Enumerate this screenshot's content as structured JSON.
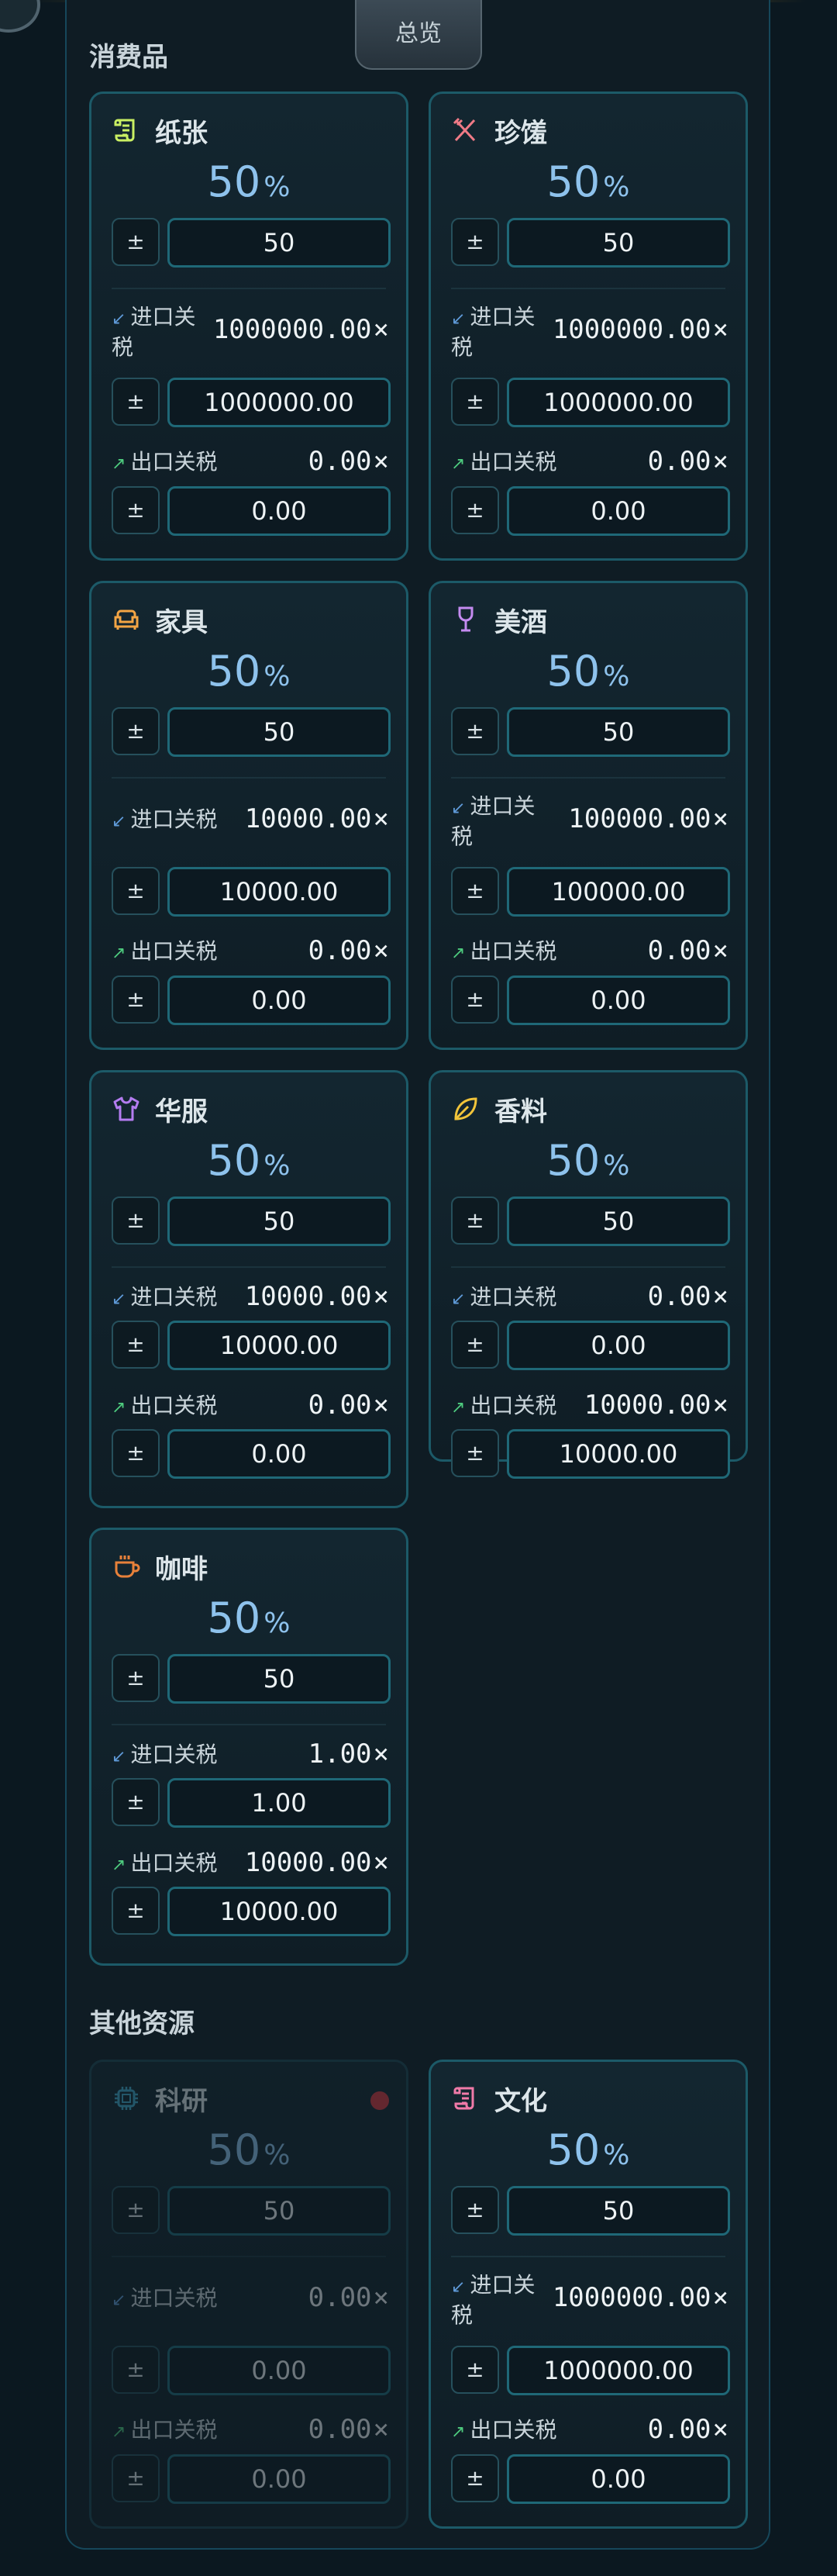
{
  "header": {
    "overview_tab": "总览"
  },
  "sections": [
    {
      "title": "消费品"
    },
    {
      "title": "其他资源"
    }
  ],
  "common": {
    "stepper_symbol": "±",
    "percent_unit": "%",
    "multiplier_symbol": "×"
  },
  "cards": [
    {
      "name": "纸张",
      "icon": "scroll-icon",
      "icon_color": "#c9ef63",
      "percent": "50",
      "amount": "50",
      "import_label": "进口关税",
      "import_value": "1000000.00",
      "import_input": "1000000.00",
      "export_label": "出口关税",
      "export_value": "0.00",
      "export_input": "0.00"
    },
    {
      "name": "珍馐",
      "icon": "fork-knife-icon",
      "icon_color": "#f07a86",
      "percent": "50",
      "amount": "50",
      "import_label": "进口关税",
      "import_value": "1000000.00",
      "import_input": "1000000.00",
      "export_label": "出口关税",
      "export_value": "0.00",
      "export_input": "0.00"
    },
    {
      "name": "家具",
      "icon": "sofa-icon",
      "icon_color": "#f3a544",
      "percent": "50",
      "amount": "50",
      "import_label": "进口关税",
      "import_value": "10000.00",
      "import_input": "10000.00",
      "export_label": "出口关税",
      "export_value": "0.00",
      "export_input": "0.00"
    },
    {
      "name": "美酒",
      "icon": "wine-glass-icon",
      "icon_color": "#c48bf0",
      "percent": "50",
      "amount": "50",
      "import_label": "进口关税",
      "import_value": "100000.00",
      "import_input": "100000.00",
      "export_label": "出口关税",
      "export_value": "0.00",
      "export_input": "0.00"
    },
    {
      "name": "华服",
      "icon": "shirt-icon",
      "icon_color": "#b47cf0",
      "percent": "50",
      "amount": "50",
      "import_label": "进口关税",
      "import_value": "10000.00",
      "import_input": "10000.00",
      "export_label": "出口关税",
      "export_value": "0.00",
      "export_input": "0.00"
    },
    {
      "name": "香料",
      "icon": "leaf-icon",
      "icon_color": "#f1c43a",
      "percent": "50",
      "amount": "50",
      "import_label": "进口关税",
      "import_value": "0.00",
      "import_input": "0.00",
      "export_label": "出口关税",
      "export_value": "10000.00",
      "export_input": "10000.00"
    },
    {
      "name": "咖啡",
      "icon": "coffee-cup-icon",
      "icon_color": "#e8813a",
      "percent": "50",
      "amount": "50",
      "import_label": "进口关税",
      "import_value": "1.00",
      "import_input": "1.00",
      "export_label": "出口关税",
      "export_value": "10000.00",
      "export_input": "10000.00"
    },
    {
      "name": "科研",
      "icon": "chip-icon",
      "icon_color": "#3fa7c9",
      "disabled": true,
      "status": "red-dot",
      "percent": "50",
      "amount": "50",
      "import_label": "进口关税",
      "import_value": "0.00",
      "import_input": "0.00",
      "export_label": "出口关税",
      "export_value": "0.00",
      "export_input": "0.00"
    },
    {
      "name": "文化",
      "icon": "scroll-icon",
      "icon_color": "#f07aa8",
      "percent": "50",
      "amount": "50",
      "import_label": "进口关税",
      "import_value": "1000000.00",
      "import_input": "1000000.00",
      "export_label": "出口关税",
      "export_value": "0.00",
      "export_input": "0.00"
    }
  ]
}
